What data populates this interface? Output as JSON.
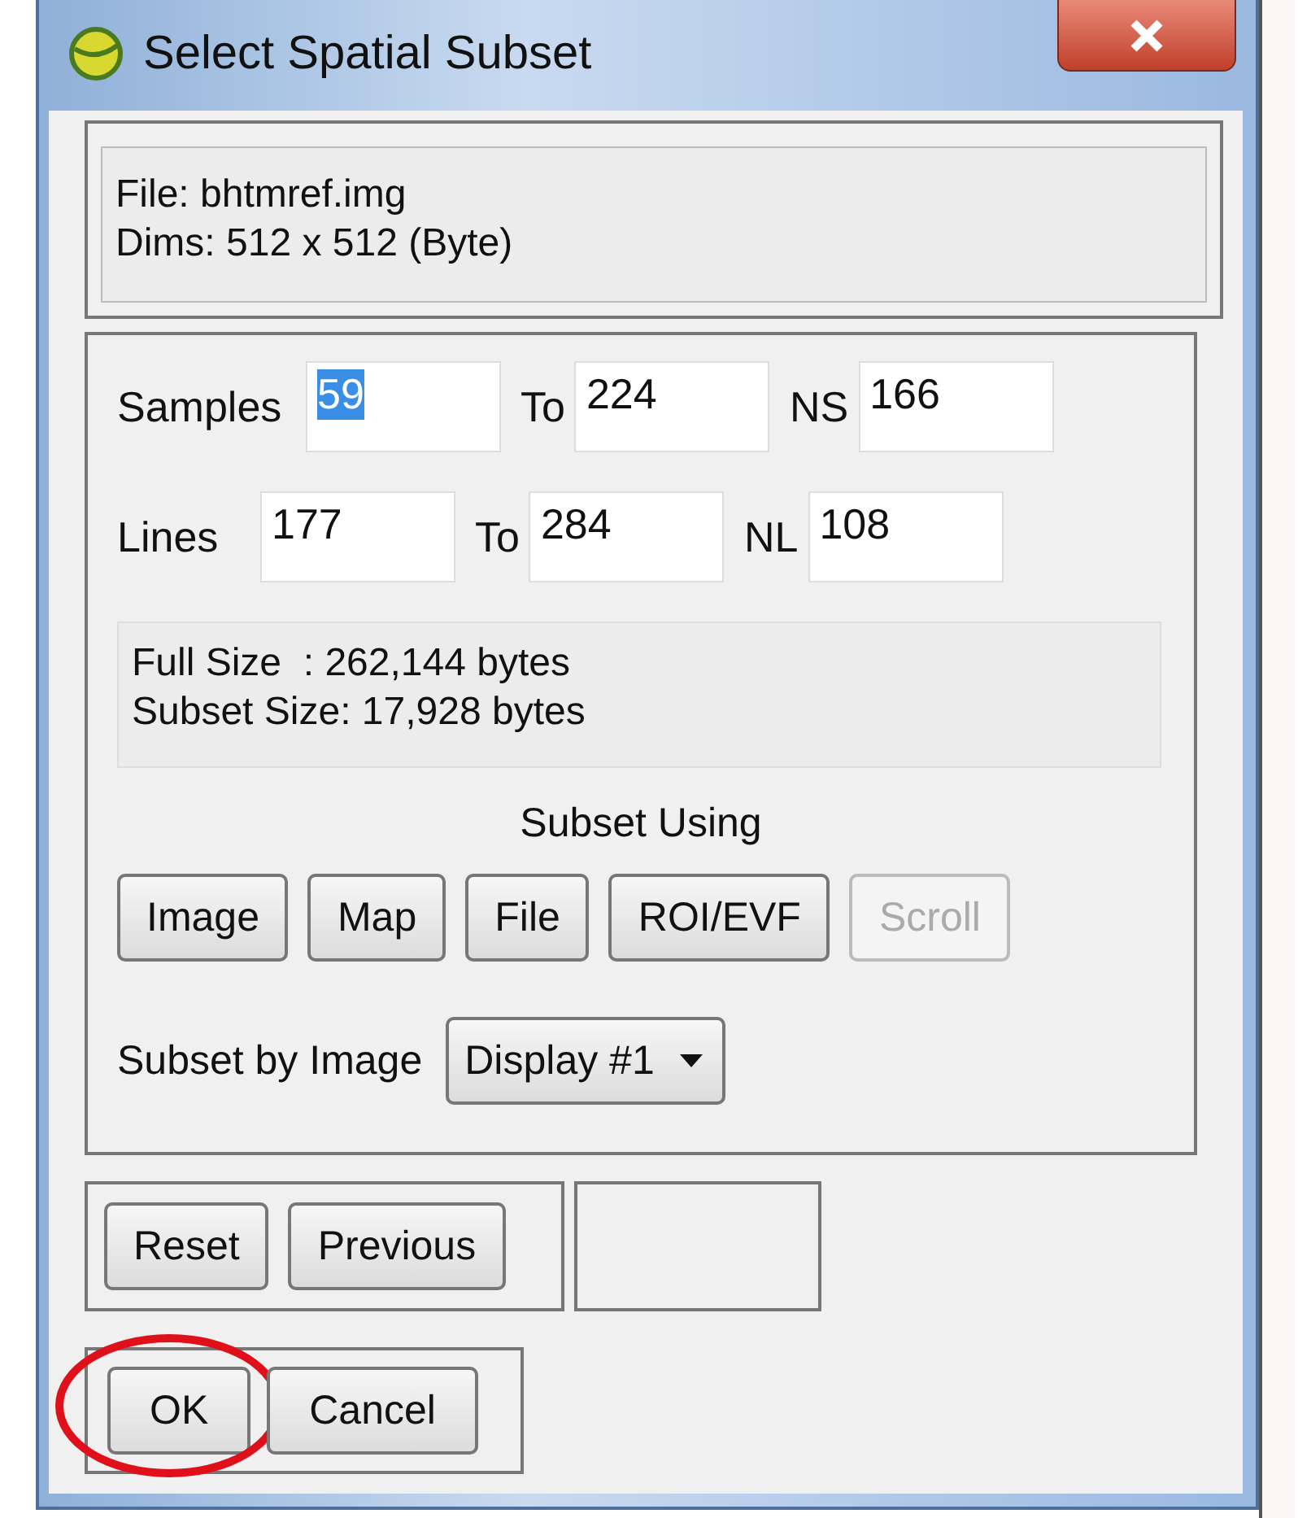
{
  "window": {
    "title": "Select Spatial Subset"
  },
  "file_info": [
    "File: bhtmref.img",
    "Dims: 512 x 512 (Byte)"
  ],
  "range_rows": [
    {
      "label": "Samples",
      "fields": [
        {
          "value": "59",
          "text_selected": true
        },
        {
          "label": "To",
          "value": "224",
          "text_selected": false
        },
        {
          "label": "NS",
          "value": "166",
          "text_selected": false
        }
      ]
    },
    {
      "label": "Lines",
      "fields": [
        {
          "value": "177",
          "text_selected": false
        },
        {
          "label": "To",
          "value": "284",
          "text_selected": false
        },
        {
          "label": "NL",
          "value": "108",
          "text_selected": false
        }
      ]
    }
  ],
  "size_info": [
    "Full Size  : 262,144 bytes",
    "Subset Size: 17,928 bytes"
  ],
  "subset_using": {
    "label": "Subset Using",
    "buttons": [
      {
        "label": "Image",
        "disabled": false
      },
      {
        "label": "Map",
        "disabled": false
      },
      {
        "label": "File",
        "disabled": false
      },
      {
        "label": "ROI/EVF",
        "disabled": false
      },
      {
        "label": "Scroll",
        "disabled": true
      }
    ]
  },
  "subset_by_image": {
    "label": "Subset by Image",
    "value": "Display #1"
  },
  "reset_buttons": [
    {
      "label": "Reset"
    },
    {
      "label": "Previous"
    }
  ],
  "dialog_buttons": [
    {
      "label": "OK",
      "highlighted": true
    },
    {
      "label": "Cancel",
      "highlighted": false
    }
  ]
}
